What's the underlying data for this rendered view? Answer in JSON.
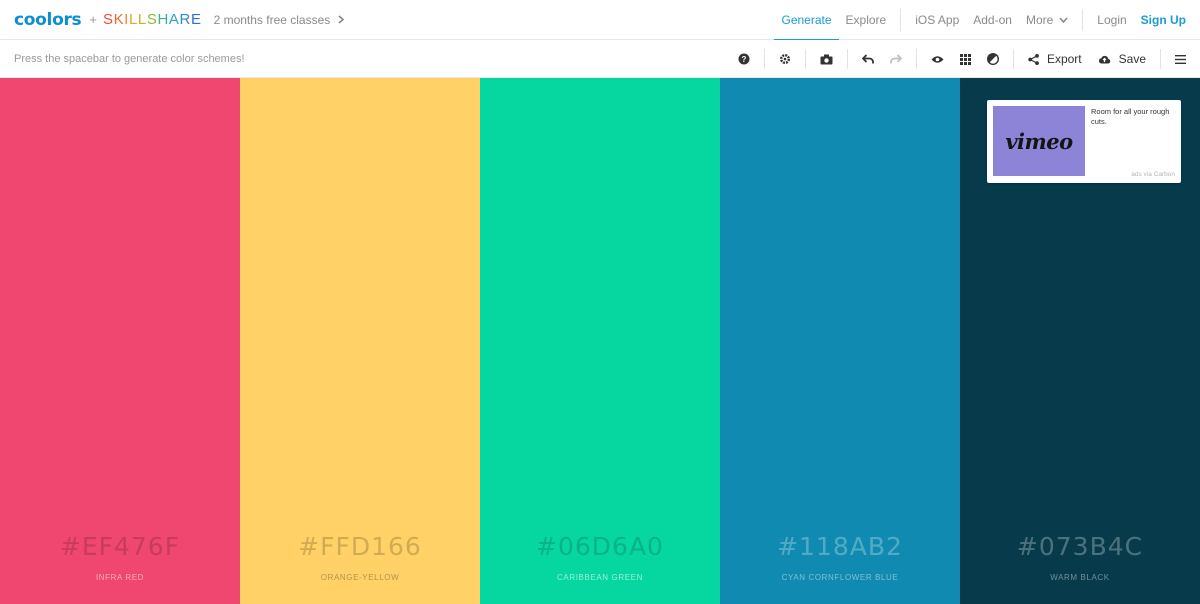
{
  "brand": {
    "logo_text": "coolors",
    "plus": "+",
    "partner_letters": [
      {
        "ch": "S",
        "color": "#ef4b3a"
      },
      {
        "ch": "K",
        "color": "#f26a32"
      },
      {
        "ch": "I",
        "color": "#f28a2c"
      },
      {
        "ch": "L",
        "color": "#e9a423"
      },
      {
        "ch": "L",
        "color": "#c6b21e"
      },
      {
        "ch": "S",
        "color": "#8bbb2e"
      },
      {
        "ch": "H",
        "color": "#3ab48e"
      },
      {
        "ch": "A",
        "color": "#2aa3c7"
      },
      {
        "ch": "R",
        "color": "#2a8bd0"
      },
      {
        "ch": "E",
        "color": "#2c6fd6"
      }
    ],
    "promo_text": "2 months free classes",
    "logo_color": "#0a8fd0"
  },
  "nav": {
    "generate": "Generate",
    "explore": "Explore",
    "ios_app": "iOS App",
    "add_on": "Add-on",
    "more": "More",
    "login": "Login",
    "signup": "Sign Up",
    "accent": "#1b9bd8"
  },
  "toolbar": {
    "hint": "Press the spacebar to generate color schemes!",
    "export_label": "Export",
    "save_label": "Save",
    "icons": [
      "help-icon",
      "settings-icon",
      "camera-icon",
      "undo-icon",
      "redo-icon",
      "view-icon",
      "grid-icon",
      "adjust-icon",
      "share-icon",
      "cloud-upload-icon",
      "menu-icon"
    ]
  },
  "palette": [
    {
      "hex": "#EF476F",
      "name": "INFRA RED",
      "bg": "#EF476F"
    },
    {
      "hex": "#FFD166",
      "name": "ORANGE-YELLOW",
      "bg": "#FFD166"
    },
    {
      "hex": "#06D6A0",
      "name": "CARIBBEAN GREEN",
      "bg": "#06D6A0"
    },
    {
      "hex": "#118AB2",
      "name": "CYAN CORNFLOWER BLUE",
      "bg": "#118AB2"
    },
    {
      "hex": "#073B4C",
      "name": "WARM BLACK",
      "bg": "#073B4C"
    }
  ],
  "ad": {
    "image_text": "vimeo",
    "text": "Room for all your rough cuts.",
    "via": "ads via Carbon"
  }
}
